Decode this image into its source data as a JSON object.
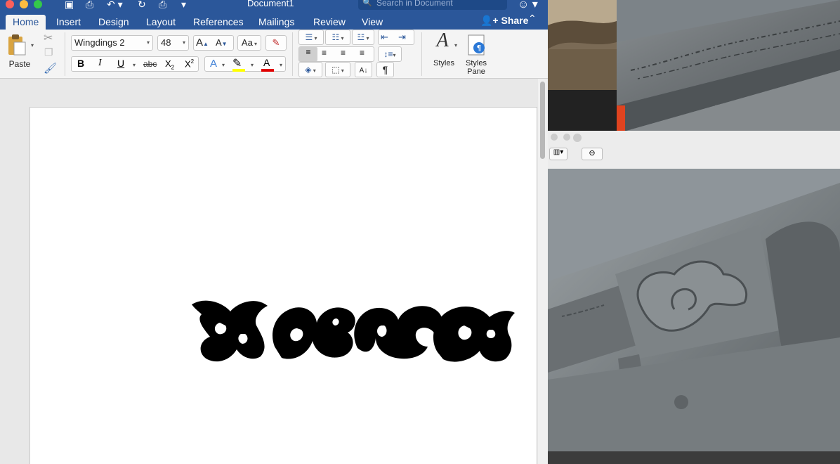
{
  "window": {
    "title": "Document1",
    "search_placeholder": "Search in Document"
  },
  "tabs": [
    "Home",
    "Insert",
    "Design",
    "Layout",
    "References",
    "Mailings",
    "Review",
    "View"
  ],
  "share_label": "Share",
  "clipboard": {
    "paste_label": "Paste"
  },
  "font": {
    "name": "Wingdings 2",
    "size": "48"
  },
  "format_labels": {
    "bold": "B",
    "italic": "I",
    "underline": "U",
    "strike": "abc",
    "subscript": "X2",
    "superscript": "X2",
    "grow": "A",
    "shrink": "A",
    "change_case": "Aa"
  },
  "styles": {
    "styles_label": "Styles",
    "pane_label_1": "Styles",
    "pane_label_2": "Pane"
  },
  "colors": {
    "ribbon_blue": "#2b579a",
    "highlight": "#ffff00",
    "font_color": "#e00000"
  },
  "document": {
    "content": "wingdings ornament glyphs"
  }
}
